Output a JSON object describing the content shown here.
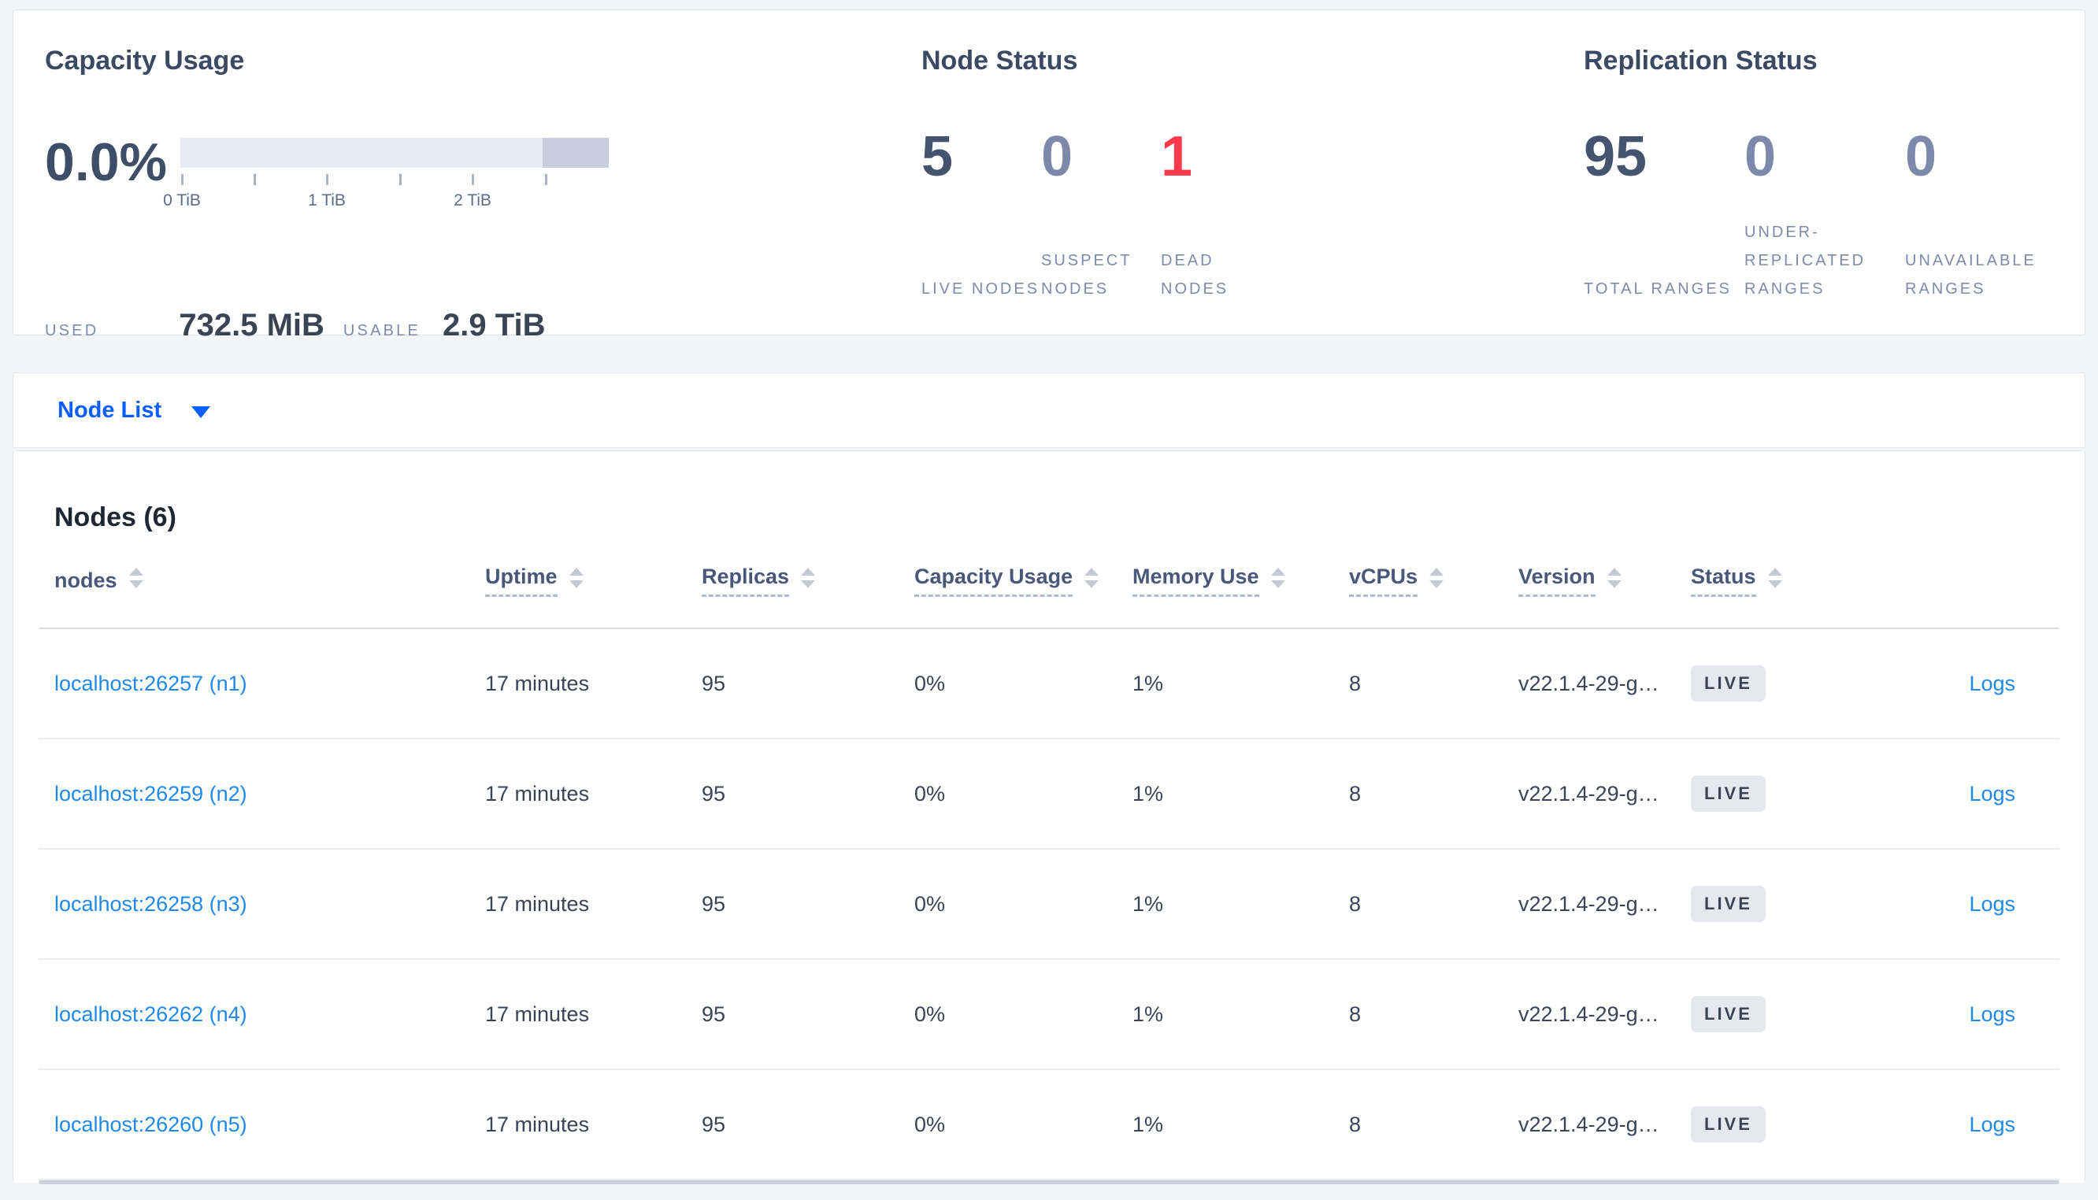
{
  "overview": {
    "capacity": {
      "title": "Capacity Usage",
      "percent": "0.0%",
      "used_label": "USED",
      "used_value": "732.5 MiB",
      "usable_label": "USABLE",
      "usable_value": "2.9 TiB",
      "axis_ticks": [
        "0 TiB",
        "1 TiB",
        "2 TiB"
      ],
      "bar_colors": {
        "usable": "#e8eaf4",
        "reserved": "#c9cede"
      }
    },
    "node_status": {
      "title": "Node Status",
      "stats": [
        {
          "value": "5",
          "label": "LIVE NODES"
        },
        {
          "value": "0",
          "label": "SUSPECT NODES"
        },
        {
          "value": "1",
          "label": "DEAD NODES"
        }
      ]
    },
    "replication_status": {
      "title": "Replication Status",
      "stats": [
        {
          "value": "95",
          "label": "TOTAL RANGES"
        },
        {
          "value": "0",
          "label": "UNDER-REPLICATED RANGES"
        },
        {
          "value": "0",
          "label": "UNAVAILABLE RANGES"
        }
      ]
    }
  },
  "view_selector": {
    "label": "Node List"
  },
  "table": {
    "title": "Nodes (6)",
    "logs_label": "Logs",
    "columns": [
      {
        "label": "nodes"
      },
      {
        "label": "Uptime"
      },
      {
        "label": "Replicas"
      },
      {
        "label": "Capacity Usage"
      },
      {
        "label": "Memory Use"
      },
      {
        "label": "vCPUs"
      },
      {
        "label": "Version"
      },
      {
        "label": "Status"
      }
    ],
    "rows": [
      {
        "node": "localhost:26257 (n1)",
        "uptime": "17 minutes",
        "replicas": "95",
        "capacity": "0%",
        "memory": "1%",
        "vcpus": "8",
        "version": "v22.1.4-29-g…",
        "status": "LIVE"
      },
      {
        "node": "localhost:26259 (n2)",
        "uptime": "17 minutes",
        "replicas": "95",
        "capacity": "0%",
        "memory": "1%",
        "vcpus": "8",
        "version": "v22.1.4-29-g…",
        "status": "LIVE"
      },
      {
        "node": "localhost:26258 (n3)",
        "uptime": "17 minutes",
        "replicas": "95",
        "capacity": "0%",
        "memory": "1%",
        "vcpus": "8",
        "version": "v22.1.4-29-g…",
        "status": "LIVE"
      },
      {
        "node": "localhost:26262 (n4)",
        "uptime": "17 minutes",
        "replicas": "95",
        "capacity": "0%",
        "memory": "1%",
        "vcpus": "8",
        "version": "v22.1.4-29-g…",
        "status": "LIVE"
      },
      {
        "node": "localhost:26260 (n5)",
        "uptime": "17 minutes",
        "replicas": "95",
        "capacity": "0%",
        "memory": "1%",
        "vcpus": "8",
        "version": "v22.1.4-29-g…",
        "status": "LIVE"
      }
    ]
  },
  "colors": {
    "link_blue": "#0b5eff",
    "table_link_blue": "#2089e8",
    "dead_red": "#ff3b4b",
    "muted_slate": "#7d89ab",
    "dark_slate": "#3a4456",
    "badge_bg": "#e5e8ee"
  }
}
